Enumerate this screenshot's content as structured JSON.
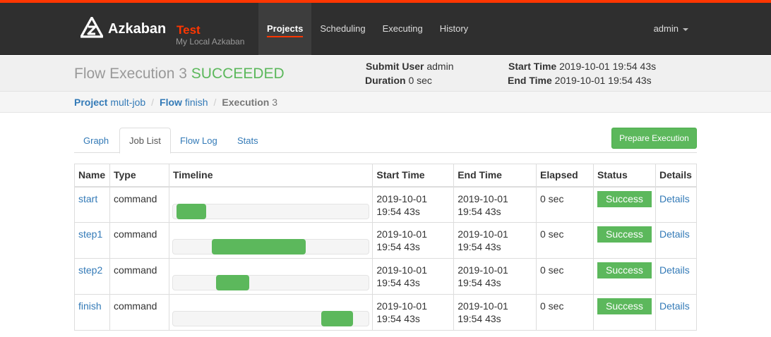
{
  "brand": {
    "name": "Azkaban",
    "env": "Test",
    "subtitle": "My Local Azkaban"
  },
  "nav": {
    "items": [
      {
        "label": "Projects",
        "active": true
      },
      {
        "label": "Scheduling"
      },
      {
        "label": "Executing"
      },
      {
        "label": "History"
      }
    ],
    "user": "admin"
  },
  "header": {
    "title_prefix": "Flow Execution 3",
    "status": "SUCCEEDED",
    "submit_user_label": "Submit User",
    "submit_user": "admin",
    "duration_label": "Duration",
    "duration": "0 sec",
    "start_time_label": "Start Time",
    "start_time": "2019-10-01 19:54 43s",
    "end_time_label": "End Time",
    "end_time": "2019-10-01 19:54 43s"
  },
  "breadcrumb": {
    "project_label": "Project",
    "project": "mult-job",
    "flow_label": "Flow",
    "flow": "finish",
    "execution_label": "Execution",
    "execution": "3"
  },
  "tabs": [
    {
      "label": "Graph"
    },
    {
      "label": "Job List",
      "active": true
    },
    {
      "label": "Flow Log"
    },
    {
      "label": "Stats"
    }
  ],
  "prepare_button": "Prepare Execution",
  "table": {
    "headers": [
      "Name",
      "Type",
      "Timeline",
      "Start Time",
      "End Time",
      "Elapsed",
      "Status",
      "Details"
    ],
    "rows": [
      {
        "name": "start",
        "type": "command",
        "tl_start": 0.02,
        "tl_end": 0.17,
        "start_date": "2019-10-01",
        "start_time": "19:54 43s",
        "end_date": "2019-10-01",
        "end_time": "19:54 43s",
        "elapsed": "0 sec",
        "status": "Success",
        "details": "Details"
      },
      {
        "name": "step1",
        "type": "command",
        "tl_start": 0.2,
        "tl_end": 0.68,
        "start_date": "2019-10-01",
        "start_time": "19:54 43s",
        "end_date": "2019-10-01",
        "end_time": "19:54 43s",
        "elapsed": "0 sec",
        "status": "Success",
        "details": "Details"
      },
      {
        "name": "step2",
        "type": "command",
        "tl_start": 0.22,
        "tl_end": 0.39,
        "start_date": "2019-10-01",
        "start_time": "19:54 43s",
        "end_date": "2019-10-01",
        "end_time": "19:54 43s",
        "elapsed": "0 sec",
        "status": "Success",
        "details": "Details"
      },
      {
        "name": "finish",
        "type": "command",
        "tl_start": 0.76,
        "tl_end": 0.92,
        "start_date": "2019-10-01",
        "start_time": "19:54 43s",
        "end_date": "2019-10-01",
        "end_time": "19:54 43s",
        "elapsed": "0 sec",
        "status": "Success",
        "details": "Details"
      }
    ]
  },
  "colors": {
    "accent": "#ff3601",
    "success": "#5cb85c",
    "link": "#337ab7",
    "navbar": "#2f2f2f"
  }
}
